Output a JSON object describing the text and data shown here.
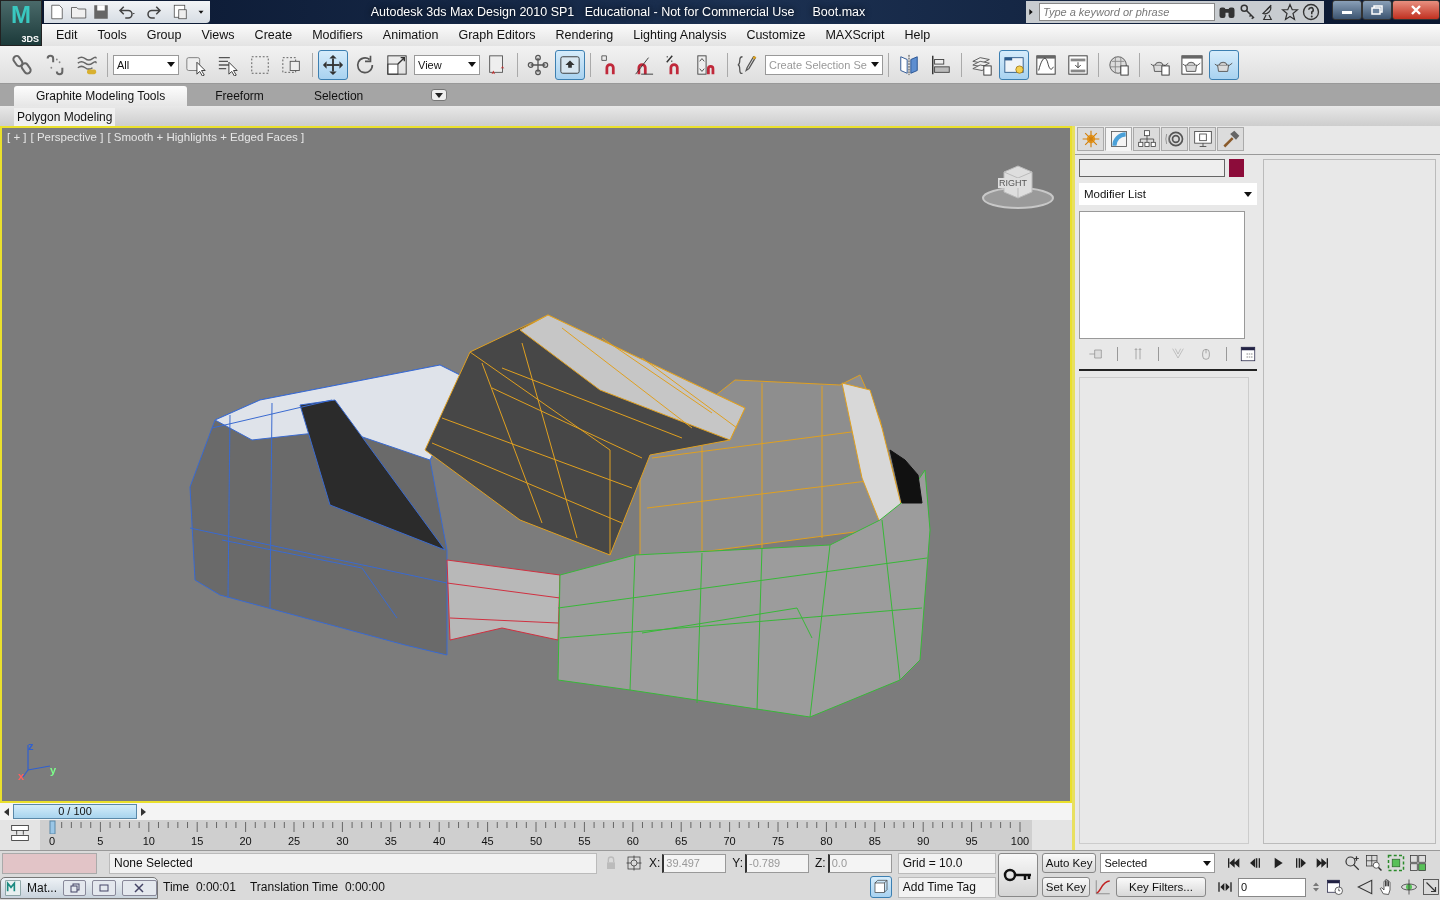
{
  "window": {
    "title": "Autodesk 3ds Max Design 2010 SP1   Educational - Not for Commercial Use",
    "file": "Boot.max"
  },
  "logo": {
    "mark": "M",
    "label": "3DS"
  },
  "search": {
    "placeholder": "Type a keyword or phrase"
  },
  "menu": [
    "Edit",
    "Tools",
    "Group",
    "Views",
    "Create",
    "Modifiers",
    "Animation",
    "Graph Editors",
    "Rendering",
    "Lighting Analysis",
    "Customize",
    "MAXScript",
    "Help"
  ],
  "main_toolbar": [
    {
      "kind": "button",
      "pressed": false
    },
    {
      "kind": "button",
      "pressed": false
    },
    {
      "kind": "button",
      "pressed": false
    },
    {
      "kind": "separator"
    },
    {
      "kind": "dropdown",
      "value": "All"
    },
    {
      "kind": "button",
      "pressed": false
    },
    {
      "kind": "button",
      "pressed": false
    },
    {
      "kind": "button",
      "pressed": false
    },
    {
      "kind": "button",
      "pressed": false
    },
    {
      "kind": "separator"
    },
    {
      "kind": "button",
      "pressed": true
    },
    {
      "kind": "button",
      "pressed": false
    },
    {
      "kind": "button",
      "pressed": false
    },
    {
      "kind": "dropdown",
      "value": "View"
    },
    {
      "kind": "button",
      "pressed": false
    },
    {
      "kind": "separator"
    },
    {
      "kind": "button",
      "pressed": false
    },
    {
      "kind": "button",
      "pressed": true
    },
    {
      "kind": "separator"
    },
    {
      "kind": "button",
      "pressed": false
    },
    {
      "kind": "button",
      "pressed": false
    },
    {
      "kind": "button",
      "pressed": false
    },
    {
      "kind": "button",
      "pressed": false
    },
    {
      "kind": "separator"
    },
    {
      "kind": "button",
      "pressed": false
    },
    {
      "kind": "dropdown",
      "placeholder": "Create Selection Se"
    },
    {
      "kind": "separator"
    },
    {
      "kind": "button",
      "pressed": false
    },
    {
      "kind": "button",
      "pressed": false
    },
    {
      "kind": "separator"
    },
    {
      "kind": "button",
      "pressed": false
    },
    {
      "kind": "button",
      "pressed": true
    },
    {
      "kind": "button",
      "pressed": false
    },
    {
      "kind": "button",
      "pressed": false
    },
    {
      "kind": "separator"
    },
    {
      "kind": "button",
      "pressed": false
    },
    {
      "kind": "separator"
    },
    {
      "kind": "button",
      "pressed": false
    },
    {
      "kind": "button",
      "pressed": false
    },
    {
      "kind": "button",
      "pressed": true
    }
  ],
  "ribbon": {
    "tabs": [
      {
        "label": "Graphite Modeling Tools",
        "selected": true
      },
      {
        "label": "Freeform",
        "selected": false
      },
      {
        "label": "Selection",
        "selected": false
      }
    ],
    "panel": "Polygon Modeling"
  },
  "viewport": {
    "labels": [
      "[ + ]",
      "[ Perspective ]",
      "[ Smooth + Highlights + Edged Faces ]"
    ],
    "active": true,
    "viewcube_face": "RIGHT",
    "axes": [
      "z",
      "x",
      "y"
    ]
  },
  "command_panel": {
    "tabs": [
      {
        "selected": false
      },
      {
        "selected": true
      },
      {
        "selected": false
      },
      {
        "selected": false
      },
      {
        "selected": false
      },
      {
        "selected": false
      }
    ],
    "modifier_list": "Modifier List"
  },
  "time_slider": {
    "label": "0 / 100"
  },
  "track_bar": {
    "ticks": [
      "0",
      "5",
      "10",
      "15",
      "20",
      "25",
      "30",
      "35",
      "40",
      "45",
      "50",
      "55",
      "60",
      "65",
      "70",
      "75",
      "80",
      "85",
      "90",
      "95",
      "100"
    ]
  },
  "status": {
    "selection": "None Selected",
    "prompt_items": [
      {
        "label": "Time",
        "value": "0:00:01"
      },
      {
        "label": "Translation Time",
        "value": "0:00:00"
      }
    ],
    "coords": [
      {
        "axis": "X:",
        "value": "39.497"
      },
      {
        "axis": "Y:",
        "value": "-0.789"
      },
      {
        "axis": "Z:",
        "value": "0.0"
      }
    ],
    "grid": "Grid = 10.0",
    "time_tag": "Add Time Tag"
  },
  "animation": {
    "auto_key": {
      "label": "Auto Key",
      "on": false
    },
    "set_key": "Set Key",
    "key_mode": "Selected",
    "key_filters": "Key Filters...",
    "frame": "0"
  },
  "minimized_window": {
    "title": "Mat..."
  }
}
